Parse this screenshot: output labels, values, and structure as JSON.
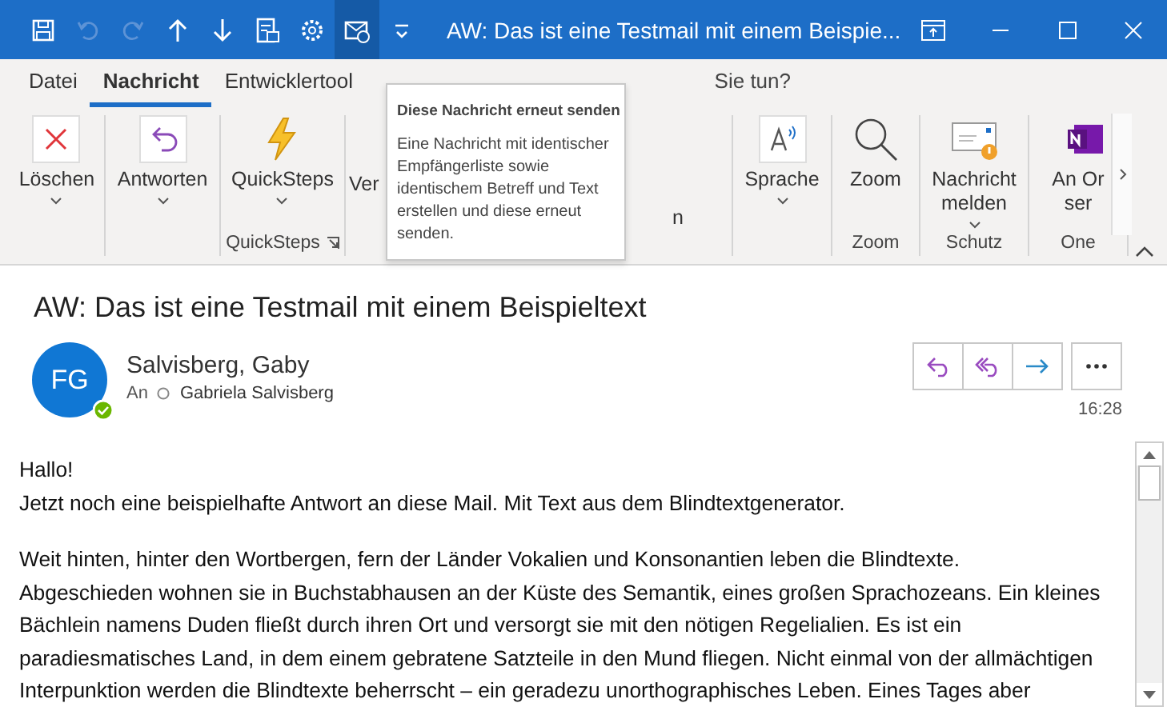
{
  "window": {
    "title": "AW: Das ist eine Testmail mit einem Beispie..."
  },
  "quick_access": [
    {
      "kind": "save",
      "disabled": false,
      "highlighted": false
    },
    {
      "kind": "undo",
      "disabled": true,
      "highlighted": false
    },
    {
      "kind": "redo",
      "disabled": true,
      "highlighted": false
    },
    {
      "kind": "up",
      "disabled": false,
      "highlighted": false
    },
    {
      "kind": "down",
      "disabled": false,
      "highlighted": false
    },
    {
      "kind": "form",
      "disabled": false,
      "highlighted": false
    },
    {
      "kind": "gear",
      "disabled": false,
      "highlighted": false
    },
    {
      "kind": "resend",
      "disabled": false,
      "highlighted": true
    },
    {
      "kind": "customize",
      "disabled": false,
      "highlighted": false
    }
  ],
  "tabs": [
    {
      "label": "Datei",
      "selected": false
    },
    {
      "label": "Nachricht",
      "selected": true
    },
    {
      "label": "Entwicklertool",
      "selected": false
    }
  ],
  "search": {
    "placeholder": "Sie tun?"
  },
  "ribbon": [
    {
      "buttons": [
        {
          "kind": "delete",
          "label": "Löschen",
          "caret": true
        }
      ]
    },
    {
      "buttons": [
        {
          "kind": "reply",
          "label": "Antworten",
          "caret": true
        }
      ]
    },
    {
      "label": "QuickSteps",
      "launcher": true,
      "buttons": [
        {
          "kind": "quicksteps",
          "label": "QuickSteps",
          "caret": true
        }
      ]
    },
    {
      "buttons": [
        {
          "kind": "text",
          "label": "Ver"
        }
      ]
    },
    {
      "buttons": [
        {
          "kind": "text",
          "label": "n"
        }
      ]
    },
    {
      "buttons": [
        {
          "kind": "speech",
          "label": "Sprache",
          "caret": true
        }
      ]
    },
    {
      "label": "Zoom",
      "buttons": [
        {
          "kind": "zoom",
          "label": "Zoom",
          "caret": false
        }
      ]
    },
    {
      "label": "Schutz",
      "buttons": [
        {
          "kind": "report",
          "label": "Nachricht melden",
          "caret": true
        }
      ]
    },
    {
      "label": "One",
      "buttons": [
        {
          "kind": "onenote",
          "label": "An Or ser",
          "caret": false
        }
      ]
    }
  ],
  "tooltip": {
    "title": "Diese Nachricht erneut senden",
    "text": "Eine Nachricht mit identischer Empfängerliste sowie identischem Betreff und Text erstellen und diese erneut senden."
  },
  "message": {
    "subject": "AW: Das ist eine Testmail mit einem Beispieltext",
    "avatar": "FG",
    "sender": "Salvisberg, Gaby",
    "to_label": "An",
    "recipient": "Gabriela Salvisberg",
    "time": "16:28",
    "actions": [
      {
        "kind": "reply"
      },
      {
        "kind": "reply_all"
      },
      {
        "kind": "forward"
      },
      {
        "kind": "more"
      }
    ],
    "body": [
      [
        "Hallo!",
        "Jetzt noch eine beispielhafte Antwort an diese Mail. Mit Text aus dem Blindtextgenerator."
      ],
      [
        "Weit hinten, hinter den Wortbergen, fern der Länder Vokalien und Konsonantien leben die Blindtexte.",
        "Abgeschieden wohnen sie in Buchstabhausen an der Küste des Semantik, eines großen Sprachozeans. Ein kleines",
        "Bächlein namens Duden fließt durch ihren Ort und versorgt sie mit den nötigen Regelialien. Es ist ein",
        "paradiesmatisches Land, in dem einem gebratene Satzteile in den Mund fliegen. Nicht einmal von der allmächtigen",
        "Interpunktion werden die Blindtexte beherrscht – ein geradezu unorthographisches Leben. Eines Tages aber"
      ]
    ]
  }
}
